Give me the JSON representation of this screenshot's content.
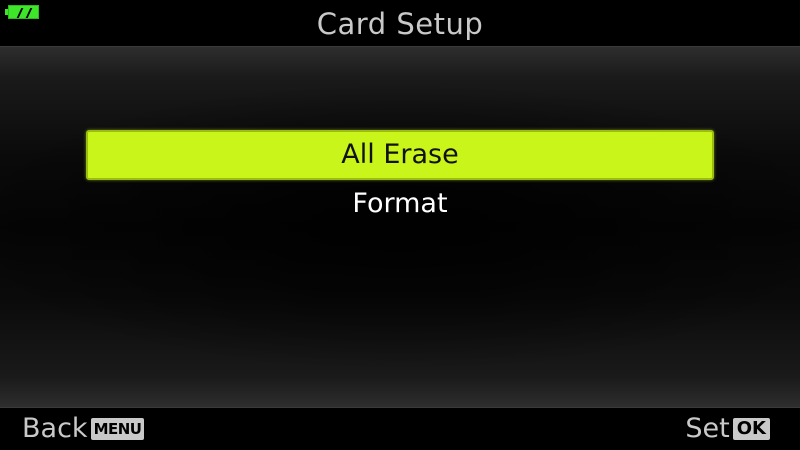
{
  "status": {
    "battery_icon": "battery-full-icon",
    "battery_color": "#3ee62a"
  },
  "header": {
    "title": "Card Setup"
  },
  "menu": {
    "items": [
      {
        "label": "All Erase",
        "selected": true
      },
      {
        "label": "Format",
        "selected": false
      }
    ],
    "highlight_color": "#c9f51a"
  },
  "footer": {
    "back_label": "Back",
    "back_key": "MENU",
    "set_label": "Set",
    "set_key": "OK"
  }
}
